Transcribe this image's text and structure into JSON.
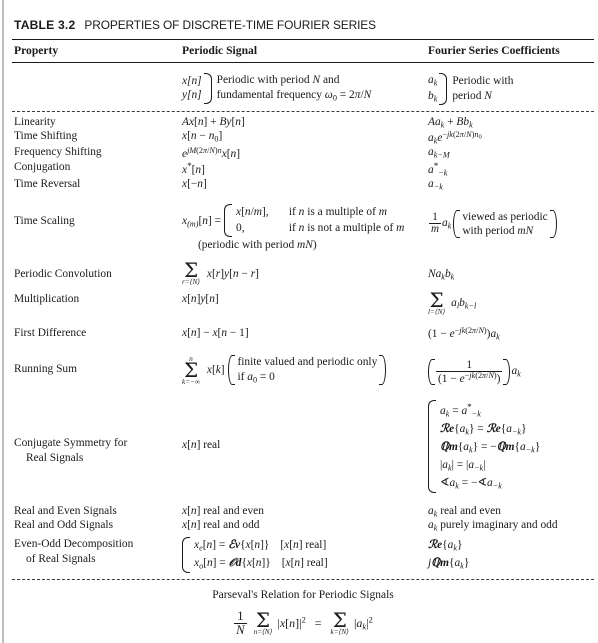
{
  "table": {
    "number": "TABLE 3.2",
    "caption": "PROPERTIES OF DISCRETE-TIME FOURIER SERIES",
    "columns": {
      "property": "Property",
      "signal": "Periodic Signal",
      "coefficients": "Fourier Series Coefficients"
    },
    "preamble": {
      "signal_line1": "x[n]",
      "signal_line2": "y[n]",
      "signal_text1": "Periodic with period N and",
      "signal_text2": "fundamental frequency ω0 = 2π/N",
      "coef_line1": "ak",
      "coef_line2": "bk",
      "coef_text1": "Periodic with",
      "coef_text2": "period N"
    },
    "rows": [
      {
        "property": "Linearity",
        "signal": "Ax[n] + By[n]",
        "coefficient": "Aak + Bbk"
      },
      {
        "property": "Time Shifting",
        "signal": "x[n − n0]",
        "coefficient": "ak e^{−jk(2π/N)n0}"
      },
      {
        "property": "Frequency Shifting",
        "signal": "e^{jM(2π/N)n} x[n]",
        "coefficient": "ak−M"
      },
      {
        "property": "Conjugation",
        "signal": "x*[n]",
        "coefficient": "a*−k"
      },
      {
        "property": "Time Reversal",
        "signal": "x[−n]",
        "coefficient": "a−k"
      },
      {
        "property": "Time Scaling",
        "signal_main": "x(m)[n] =",
        "signal_case1": "x[n/m],",
        "signal_case1_cond": "if n is a multiple of m",
        "signal_case2": "0,",
        "signal_case2_cond": "if n is not a multiple of m",
        "signal_note": "(periodic with period mN)",
        "coefficient_frac_num": "1",
        "coefficient_frac_den": "m",
        "coefficient_sym": "ak",
        "coefficient_note1": "viewed as periodic",
        "coefficient_note2": "with period mN"
      },
      {
        "property": "Periodic Convolution",
        "signal_sum_lower": "r=⟨N⟩",
        "signal_body": "x[r]y[n − r]",
        "coefficient": "Nakbk"
      },
      {
        "property": "Multiplication",
        "signal": "x[n]y[n]",
        "coefficient_sum_lower": "l=⟨N⟩",
        "coefficient_body": "albk−l"
      },
      {
        "property": "First Difference",
        "signal": "x[n] − x[n − 1]",
        "coefficient": "(1 − e^{−jk(2π/N)})ak"
      },
      {
        "property": "Running Sum",
        "signal_sum_upper": "n",
        "signal_sum_lower": "k=−∞",
        "signal_body": "x[k]",
        "signal_note1": "finite valued and periodic only",
        "signal_note2": "if a0 = 0",
        "coefficient_frac_num": "1",
        "coefficient_frac_den": "(1 − e^{−jk(2π/N)})",
        "coefficient_tail": "ak"
      },
      {
        "property_line1": "Conjugate Symmetry for",
        "property_line2": "Real Signals",
        "signal": "x[n] real",
        "coefficient_lines": [
          "ak = a*−k",
          "Re{ak} = Re{a−k}",
          "Im{ak} = −Im{a−k}",
          "|ak| = |a−k|",
          "∠ak = −∠a−k"
        ]
      },
      {
        "property": "Real and Even Signals",
        "signal": "x[n] real and even",
        "coefficient": "ak real and even"
      },
      {
        "property": "Real and Odd Signals",
        "signal": "x[n] real and odd",
        "coefficient": "ak purely imaginary and odd"
      },
      {
        "property_line1": "Even-Odd Decomposition",
        "property_line2": "of Real Signals",
        "signal_case1": "xe[n] = Ɛv{x[n]}",
        "signal_case1_tag": "[x[n] real]",
        "signal_case2": "xo[n] = Od{x[n]}",
        "signal_case2_tag": "[x[n] real]",
        "coefficient_line1": "Re{ak}",
        "coefficient_line2": "jIm{ak}"
      }
    ],
    "footer": {
      "title": "Parseval's Relation for Periodic Signals",
      "equation_frac_num": "1",
      "equation_frac_den": "N",
      "lhs_sum_lower": "n=⟨N⟩",
      "lhs_body": "|x[n]|²",
      "equals": "=",
      "rhs_sum_lower": "k=⟨N⟩",
      "rhs_body": "|ak|²"
    }
  }
}
